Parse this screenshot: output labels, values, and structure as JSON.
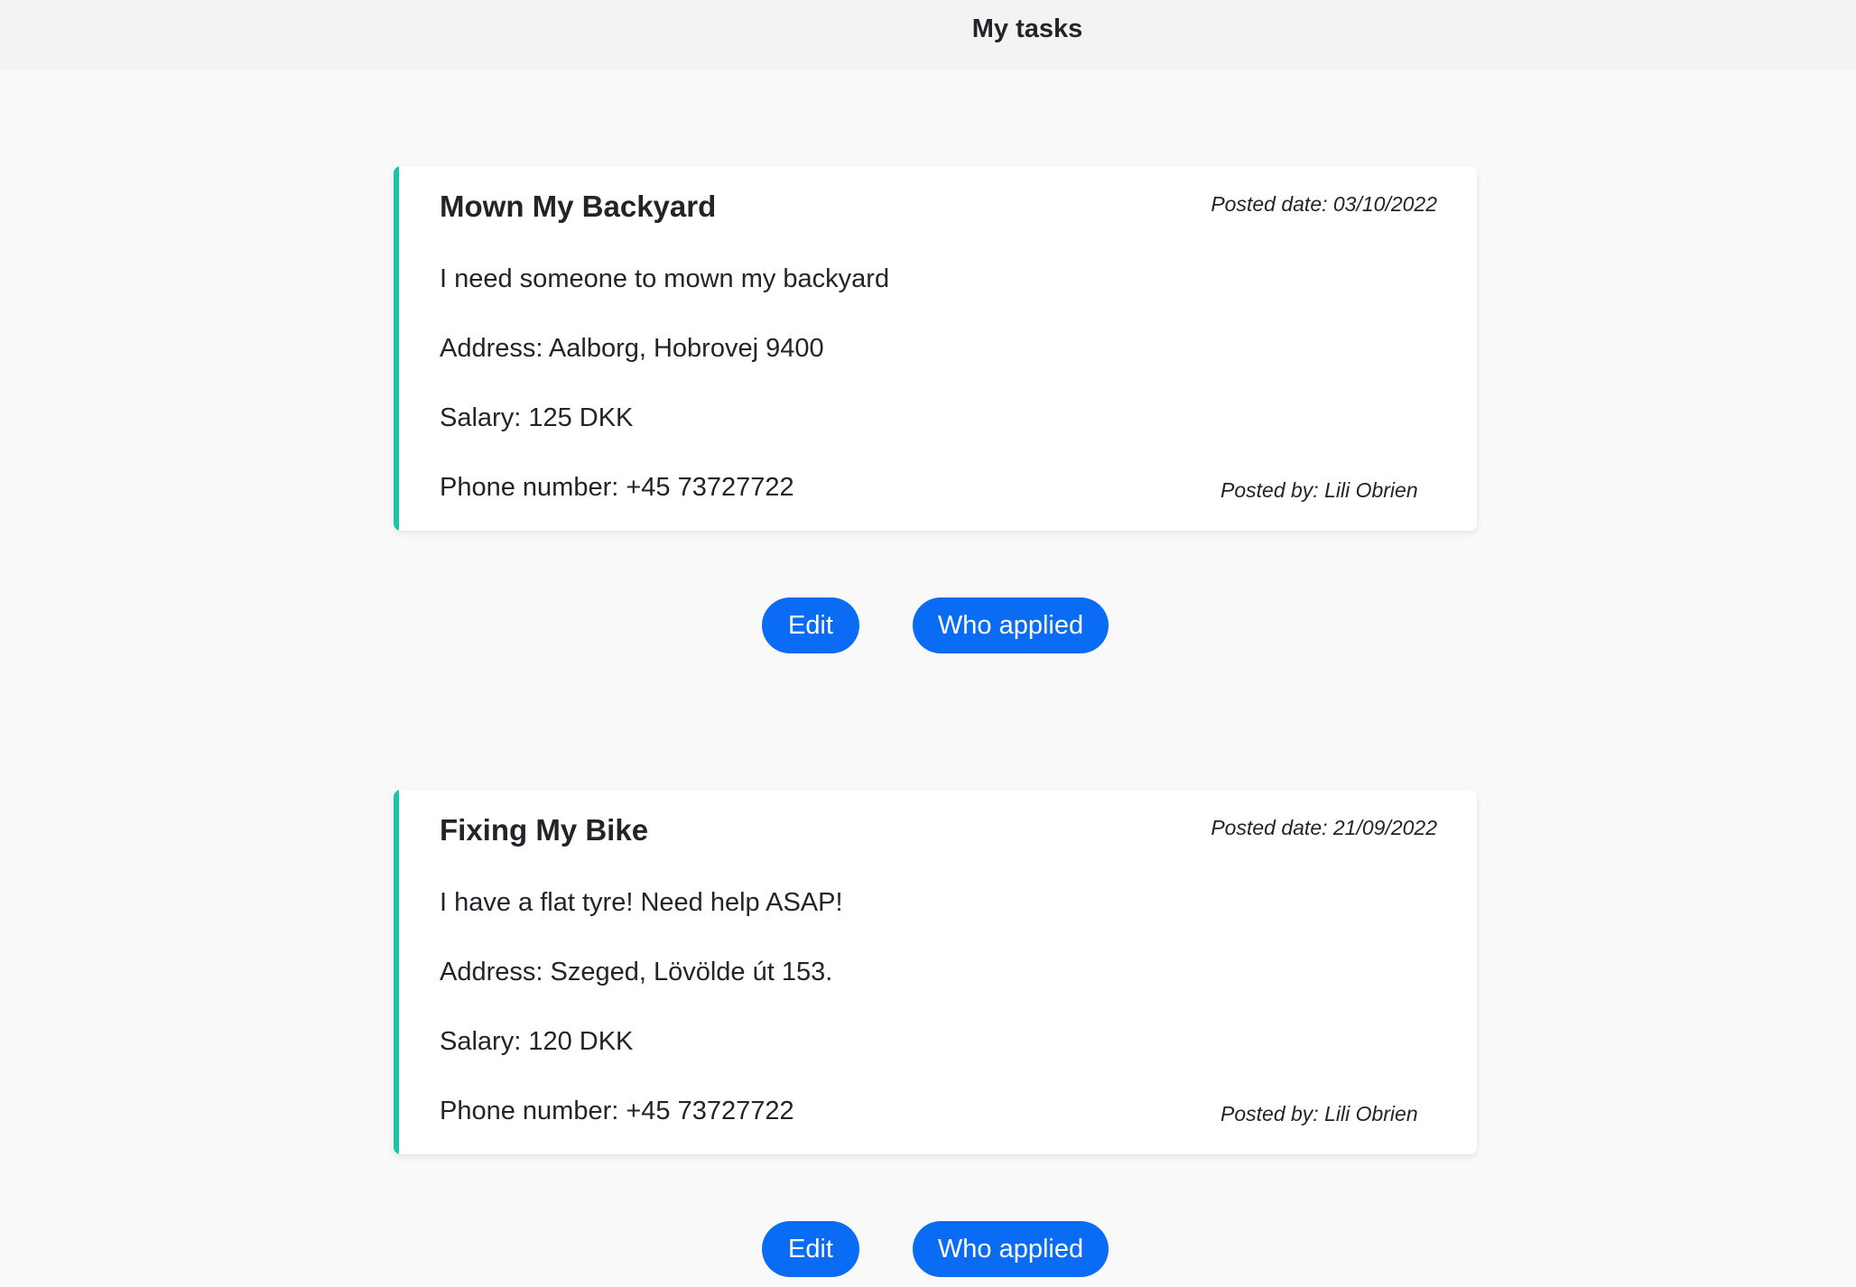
{
  "header": {
    "title": "My tasks"
  },
  "tasks": [
    {
      "title": "Mown My Backyard",
      "posted_date": "Posted date: 03/10/2022",
      "description": "I need someone to mown my backyard",
      "address": "Address: Aalborg, Hobrovej 9400",
      "salary": "Salary: 125 DKK",
      "phone": "Phone number: +45 73727722",
      "posted_by": "Posted by: Lili Obrien",
      "edit_label": "Edit",
      "applied_label": "Who applied"
    },
    {
      "title": "Fixing My Bike",
      "posted_date": "Posted date: 21/09/2022",
      "description": "I have a flat tyre! Need help ASAP!",
      "address": "Address: Szeged, Lövölde út 153.",
      "salary": "Salary: 120 DKK",
      "phone": "Phone number: +45 73727722",
      "posted_by": "Posted by: Lili Obrien",
      "edit_label": "Edit",
      "applied_label": "Who applied"
    }
  ],
  "colors": {
    "accent": "#1dc4a6",
    "button": "#0a6cf5",
    "background": "#f9f9f9",
    "header_bg": "#f3f3f3"
  }
}
